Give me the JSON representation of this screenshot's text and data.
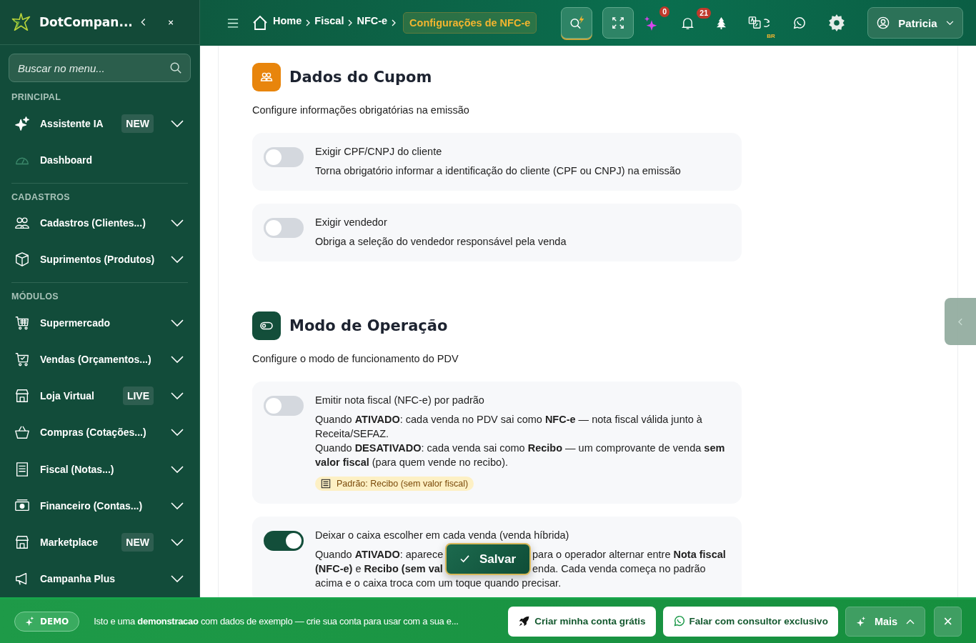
{
  "sidebar": {
    "brand": "DotCompan...",
    "search": {
      "placeholder": "Buscar no menu..."
    },
    "sections": [
      {
        "title": "PRINCIPAL",
        "items": [
          {
            "label": "Assistente IA",
            "badge": "NEW",
            "expandable": true
          },
          {
            "label": "Dashboard",
            "expandable": false
          }
        ]
      },
      {
        "title": "CADASTROS",
        "items": [
          {
            "label": "Cadastros (Clientes...)",
            "expandable": true
          },
          {
            "label": "Suprimentos (Produtos)",
            "expandable": true
          }
        ]
      },
      {
        "title": "MÓDULOS",
        "items": [
          {
            "label": "Supermercado",
            "expandable": true
          },
          {
            "label": "Vendas (Orçamentos...)",
            "expandable": true
          },
          {
            "label": "Loja Virtual",
            "badge": "LIVE",
            "expandable": true
          },
          {
            "label": "Compras (Cotações...)",
            "expandable": true
          },
          {
            "label": "Fiscal (Notas...)",
            "expandable": true
          },
          {
            "label": "Financeiro (Contas...)",
            "expandable": true
          },
          {
            "label": "Marketplace",
            "badge": "NEW",
            "expandable": true
          },
          {
            "label": "Campanha Plus",
            "expandable": true
          }
        ]
      }
    ]
  },
  "topbar": {
    "breadcrumbs": [
      "Home",
      "Fiscal",
      "NFC-e"
    ],
    "current": "Configurações de NFC-e",
    "ai_count": "0",
    "notification_count": "21",
    "language": "BR",
    "user": "Patricia"
  },
  "sections": [
    {
      "title": "Dados do Cupom",
      "subtitle": "Configure informações obrigatórias na emissão",
      "settings": [
        {
          "title": "Exigir CPF/CNPJ do cliente",
          "on": false,
          "description": "Torna obrigatório informar a identificação do cliente (CPF ou CNPJ) na emissão"
        },
        {
          "title": "Exigir vendedor",
          "on": false,
          "description": "Obriga a seleção do vendedor responsável pela venda"
        }
      ]
    },
    {
      "title": "Modo de Operação",
      "subtitle": "Configure o modo de funcionamento do PDV",
      "settings": [
        {
          "title": "Emitir nota fiscal (NFC-e) por padrão",
          "on": false,
          "paragraphs": [
            "Quando **ATIVADO**: cada venda no PDV sai como **NFC-e** — nota fiscal válida junto à Receita/SEFAZ.",
            "Quando **DESATIVADO**: cada venda sai como **Recibo** — um comprovante de venda **sem valor fiscal** (para quem vende no recibo)."
          ],
          "note": "Padrão: Recibo (sem valor fiscal)"
        },
        {
          "title": "Deixar o caixa escolher em cada venda (venda híbrida)",
          "on": true,
          "fragment_lines": [
            [
              "Quando **ATIVADO**: aparece",
              "para o operador alternar entre **Nota fiscal**"
            ],
            [
              "**(NFC-e)** e **Recibo (sem val**",
              "enda. Cada venda começa no padrão"
            ],
            [
              "acima e o caixa troca com um toque quando precisar."
            ]
          ]
        }
      ]
    }
  ],
  "save_button": "Salvar",
  "demo_banner": {
    "badge": "DEMO",
    "message": "Isto e uma **demonstracao** com dados de exemplo — crie sua conta para usar com a sua e...",
    "primary_action": "Criar minha conta grátis",
    "secondary_action": "Falar com consultor exclusivo",
    "more": "Mais",
    "close": "×"
  }
}
